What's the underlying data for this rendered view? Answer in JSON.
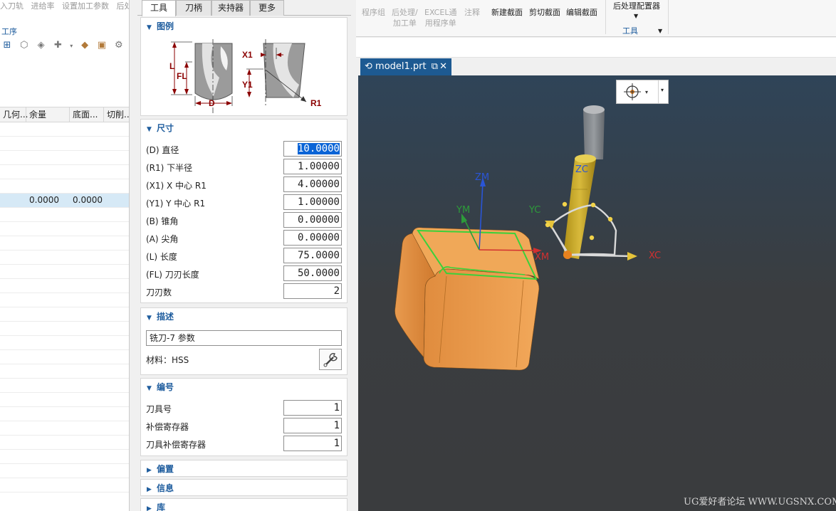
{
  "left_nav": {
    "menu": [
      "入刀轨",
      "进给率",
      "设置加工参数",
      "后处理"
    ],
    "group_label": "工序",
    "columns": [
      "几何...",
      "余量",
      "底面...",
      "切削..."
    ],
    "selected_row": {
      "col2": "0.0000",
      "col3": "0.0000"
    }
  },
  "tabs": [
    "工具",
    "刀柄",
    "夹持器",
    "更多"
  ],
  "illustration": {
    "title": "图例",
    "labels": {
      "L": "L",
      "FL": "FL",
      "D": "D",
      "X1": "X1",
      "Y1": "Y1",
      "R1": "R1"
    }
  },
  "dimensions": {
    "title": "尺寸",
    "fields": [
      {
        "label": "(D) 直径",
        "value": "10.0000"
      },
      {
        "label": "(R1) 下半径",
        "value": "1.00000"
      },
      {
        "label": "(X1) X 中心 R1",
        "value": "4.00000"
      },
      {
        "label": "(Y1) Y 中心 R1",
        "value": "1.00000"
      },
      {
        "label": "(B) 锥角",
        "value": "0.00000"
      },
      {
        "label": "(A) 尖角",
        "value": "0.00000"
      },
      {
        "label": "(L) 长度",
        "value": "75.0000"
      },
      {
        "label": "(FL) 刀刃长度",
        "value": "50.0000"
      },
      {
        "label": "刀刃数",
        "value": "2"
      }
    ]
  },
  "description": {
    "title": "描述",
    "text": "铣刀-7 参数",
    "material": "材料：HSS"
  },
  "numbering": {
    "title": "编号",
    "fields": [
      {
        "label": "刀具号",
        "value": "1"
      },
      {
        "label": "补偿寄存器",
        "value": "1"
      },
      {
        "label": "刀具补偿寄存器",
        "value": "1"
      }
    ]
  },
  "collapsed_sections": [
    "偏置",
    "信息",
    "库"
  ],
  "ribbon": {
    "buttons": [
      {
        "label": "程序组",
        "disabled": true
      },
      {
        "label": "后处理/\n加工单",
        "disabled": true
      },
      {
        "label": "EXCEL通\n用程序单",
        "disabled": true
      },
      {
        "label": "注释",
        "disabled": true
      },
      {
        "label": "新建截面",
        "disabled": false
      },
      {
        "label": "剪切截面",
        "disabled": false
      },
      {
        "label": "编辑截面",
        "disabled": false
      }
    ],
    "post_config": "后处理配置器",
    "tools_group": "工具"
  },
  "file_tab": {
    "name": "model1.prt",
    "close": "✕"
  },
  "axes": {
    "ZM": "ZM",
    "YM": "YM",
    "XM": "XM",
    "ZC": "ZC",
    "YC": "YC",
    "XC": "XC"
  },
  "watermark": "UG爱好者论坛 WWW.UGSNX.COM",
  "colors": {
    "accent": "#1f5d9e",
    "viewport": "#3a3d40",
    "block": "#e89a4e",
    "tool": "#d9b21c"
  }
}
